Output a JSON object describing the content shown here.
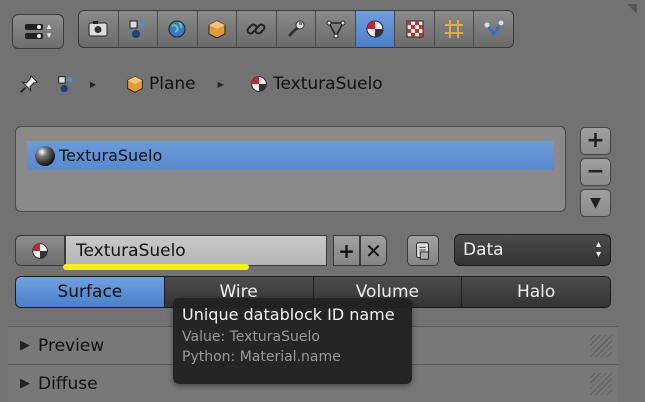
{
  "header": {
    "editor_type_icon": "properties-editor-icon",
    "context_tabs": [
      {
        "name": "render",
        "icon": "camera-icon"
      },
      {
        "name": "render-layers",
        "icon": "layers-icon"
      },
      {
        "name": "world",
        "icon": "world-icon"
      },
      {
        "name": "object",
        "icon": "object-icon"
      },
      {
        "name": "constraints",
        "icon": "constraint-icon"
      },
      {
        "name": "modifiers",
        "icon": "wrench-icon"
      },
      {
        "name": "data",
        "icon": "mesh-data-icon"
      },
      {
        "name": "material",
        "icon": "material-icon",
        "active": true
      },
      {
        "name": "texture",
        "icon": "texture-icon"
      },
      {
        "name": "particles",
        "icon": "particles-icon"
      },
      {
        "name": "physics",
        "icon": "physics-icon"
      }
    ]
  },
  "breadcrumb": {
    "object": "Plane",
    "material": "TexturaSuelo"
  },
  "slots": {
    "items": [
      "TexturaSuelo"
    ],
    "add_label": "+",
    "remove_label": "−",
    "menu_label": "▼"
  },
  "id_block": {
    "name": "TexturaSuelo",
    "add_label": "+",
    "unlink_label": "✕",
    "link_type": "Data"
  },
  "material_types": [
    {
      "label": "Surface",
      "active": true
    },
    {
      "label": "Wire"
    },
    {
      "label": "Volume"
    },
    {
      "label": "Halo"
    }
  ],
  "panels": [
    {
      "label": "Preview"
    },
    {
      "label": "Diffuse"
    }
  ],
  "tooltip": {
    "title": "Unique datablock ID name",
    "value": "Value: TexturaSuelo",
    "python": "Python: Material.name"
  },
  "colors": {
    "active_blue": "#5a8ace",
    "highlight_yellow": "#f4ef1a",
    "background": "#727272"
  }
}
